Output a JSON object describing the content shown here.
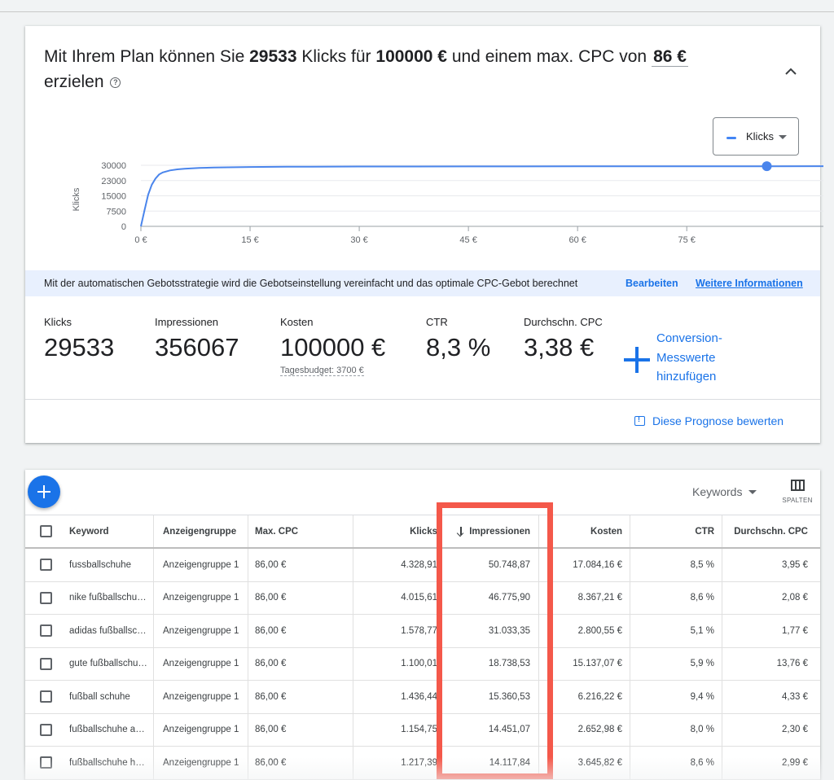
{
  "plan": {
    "prefix": "Mit Ihrem Plan können Sie ",
    "clicks": "29533",
    "mid1": " Klicks für ",
    "budget": "100000 €",
    "mid2": " und einem max. CPC von",
    "cpc": "86 €",
    "suffix": "erzielen",
    "help_icon": "?"
  },
  "legend_dropdown": {
    "label": "Klicks"
  },
  "chart_data": {
    "type": "line",
    "ylabel": "Klicks",
    "yticks": [
      "30000",
      "23000",
      "15000",
      "7500",
      "0"
    ],
    "xticks": [
      "0 €",
      "15 €",
      "30 €",
      "45 €",
      "60 €",
      "75 €"
    ],
    "ylim": [
      0,
      30000
    ],
    "xlim": [
      0,
      94
    ],
    "series": [
      {
        "x": [
          0,
          0.5,
          1,
          1.5,
          2,
          2.5,
          3,
          4,
          5,
          6,
          8,
          10,
          15,
          20,
          30,
          45,
          60,
          75,
          86,
          94
        ],
        "values": [
          0,
          8000,
          15500,
          20500,
          23500,
          25500,
          26500,
          27500,
          28000,
          28300,
          28700,
          28900,
          29150,
          29280,
          29380,
          29450,
          29490,
          29520,
          29533,
          29540
        ]
      }
    ],
    "marker": {
      "x": 86,
      "y": 29533
    },
    "color": "#4a85ec"
  },
  "banner": {
    "message": "Mit der automatischen Gebotsstrategie wird die Gebotseinstellung vereinfacht und das optimale CPC-Gebot berechnet",
    "edit": "Bearbeiten",
    "more": "Weitere Informationen"
  },
  "metrics": [
    {
      "label": "Klicks",
      "value": "29533"
    },
    {
      "label": "Impressionen",
      "value": "356067"
    },
    {
      "label": "Kosten",
      "value": "100000 €",
      "sub": "Tagesbudget: 3700 €"
    },
    {
      "label": "CTR",
      "value": "8,3 %"
    },
    {
      "label": "Durchschn. CPC",
      "value": "3,38 €"
    }
  ],
  "conversion": {
    "label": "Conversion-Messwerte hinzufügen"
  },
  "rate_link": "Diese Prognose bewerten",
  "table_toolbar": {
    "view": "Keywords",
    "columns_label": "SPALTEN"
  },
  "table": {
    "headers": [
      "Keyword",
      "Anzeigengruppe",
      "Max. CPC",
      "Klicks",
      "Impressionen",
      "Kosten",
      "CTR",
      "Durchschn. CPC"
    ],
    "rows": [
      [
        "fussballschuhe",
        "Anzeigengruppe 1",
        "86,00 €",
        "4.328,91",
        "50.748,87",
        "17.084,16 €",
        "8,5 %",
        "3,95 €"
      ],
      [
        "nike fußballschu…",
        "Anzeigengruppe 1",
        "86,00 €",
        "4.015,61",
        "46.775,90",
        "8.367,21 €",
        "8,6 %",
        "2,08 €"
      ],
      [
        "adidas fußballsc…",
        "Anzeigengruppe 1",
        "86,00 €",
        "1.578,77",
        "31.033,35",
        "2.800,55 €",
        "5,1 %",
        "1,77 €"
      ],
      [
        "gute fußballschu…",
        "Anzeigengruppe 1",
        "86,00 €",
        "1.100,01",
        "18.738,53",
        "15.137,07 €",
        "5,9 %",
        "13,76 €"
      ],
      [
        "fußball schuhe",
        "Anzeigengruppe 1",
        "86,00 €",
        "1.436,44",
        "15.360,53",
        "6.216,22 €",
        "9,4 %",
        "4,33 €"
      ],
      [
        "fußballschuhe a…",
        "Anzeigengruppe 1",
        "86,00 €",
        "1.154,75",
        "14.451,07",
        "2.652,98 €",
        "8,0 %",
        "2,30 €"
      ],
      [
        "fußballschuhe h…",
        "Anzeigengruppe 1",
        "86,00 €",
        "1.217,39",
        "14.117,84",
        "3.645,82 €",
        "8,6 %",
        "2,99 €"
      ]
    ]
  },
  "colors": {
    "accent": "#1a73e8",
    "highlight": "#f4584a",
    "banner": "#e8f0fe"
  }
}
